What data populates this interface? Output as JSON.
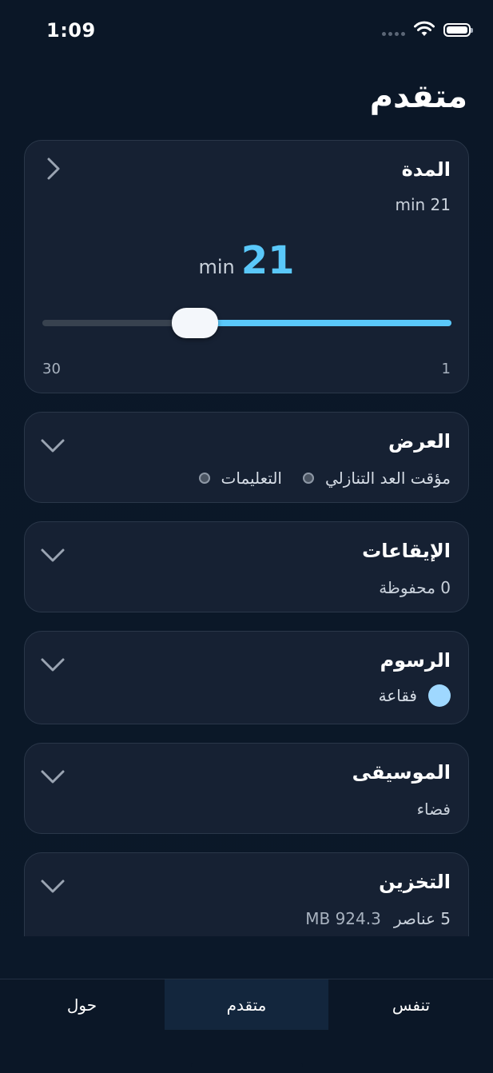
{
  "status": {
    "time": "1:09"
  },
  "page": {
    "title": "متقدم"
  },
  "duration": {
    "title": "المدة",
    "subtitle": "21 min",
    "value": "21",
    "unit": "min",
    "min_label": "30",
    "max_label": "1",
    "slider_fraction_from_right": 0.62
  },
  "display": {
    "title": "العرض",
    "options": [
      "مؤقت العد التنازلي",
      "التعليمات"
    ]
  },
  "rhythms": {
    "title": "الإيقاعات",
    "subtitle": "0 محفوظة"
  },
  "graphics": {
    "title": "الرسوم",
    "selected": "فقاعة",
    "swatch_color": "#9fd8ff"
  },
  "music": {
    "title": "الموسيقى",
    "subtitle": "فضاء"
  },
  "storage": {
    "title": "التخزين",
    "items": "5 عناصر",
    "size": "924.3 MB"
  },
  "tabs": [
    "تنفس",
    "متقدم",
    "حول"
  ],
  "colors": {
    "accent": "#5ac8fa",
    "background": "#0b1727",
    "card": "#162133"
  },
  "icons": [
    "wifi-icon",
    "battery-icon",
    "chevron-right-icon",
    "chevron-down-icon"
  ]
}
